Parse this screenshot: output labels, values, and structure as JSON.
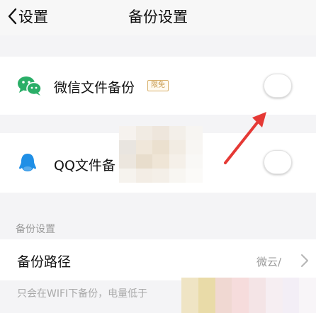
{
  "nav": {
    "back_label": "设置",
    "title": "备份设置"
  },
  "wechat_backup": {
    "label": "微信文件备份",
    "badge": "限免",
    "icon": "wechat-icon",
    "toggle_on": false
  },
  "qq_backup": {
    "label": "QQ文件备",
    "icon": "qq-penguin-icon",
    "toggle_on": false
  },
  "backup_settings": {
    "section_title": "备份设置",
    "path_label": "备份路径",
    "path_value": "微云/",
    "note": "只会在WIFI下备份，电量低于"
  },
  "colors": {
    "wechat_green": "#2aae67",
    "qq_blue": "#1f8fe6",
    "annotation_red": "#e53935",
    "badge_gold": "#c89a4d"
  }
}
